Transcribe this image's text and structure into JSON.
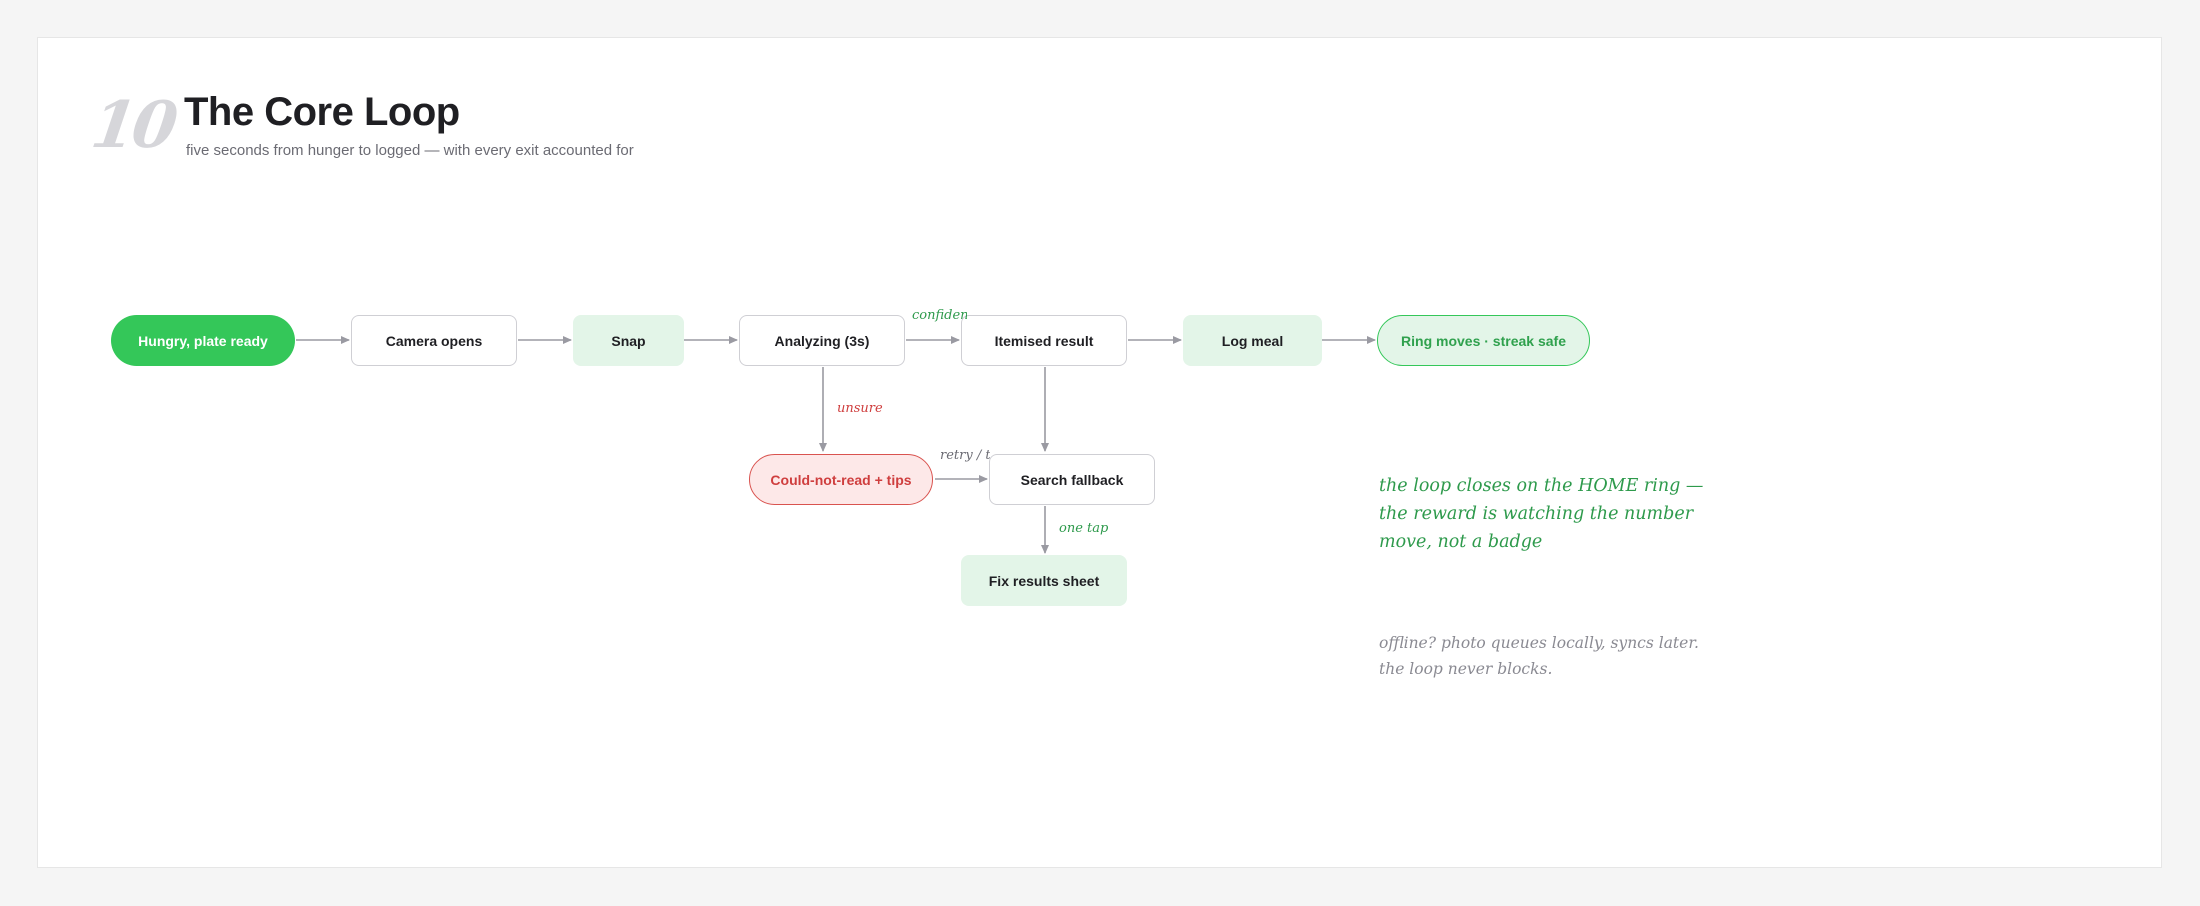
{
  "header": {
    "slide_number": "10",
    "title": "The Core Loop",
    "subtitle": "five seconds from hunger to logged — with every exit accounted for"
  },
  "nodes": {
    "hungry": "Hungry, plate ready",
    "camera": "Camera opens",
    "snap": "Snap",
    "analyzing": "Analyzing (3s)",
    "itemised": "Itemised result",
    "log_meal": "Log meal",
    "ring": "Ring moves · streak safe",
    "could_not_read": "Could-not-read + tips",
    "search_fallback": "Search fallback",
    "fix_results": "Fix results sheet"
  },
  "edge_labels": {
    "confident": "confident",
    "unsure": "unsure",
    "retry": "retry / t",
    "one_tap": "one tap"
  },
  "notes": {
    "loop_closes": "the loop closes on the HOME ring — the reward is watching the number move, not a badge",
    "offline": "offline? photo queues locally, syncs later. the loop never blocks."
  },
  "colors": {
    "accent_green": "#34c759",
    "mint": "#e3f5e8",
    "error_red": "#d9534f",
    "edge_gray": "#9a9aa2"
  }
}
